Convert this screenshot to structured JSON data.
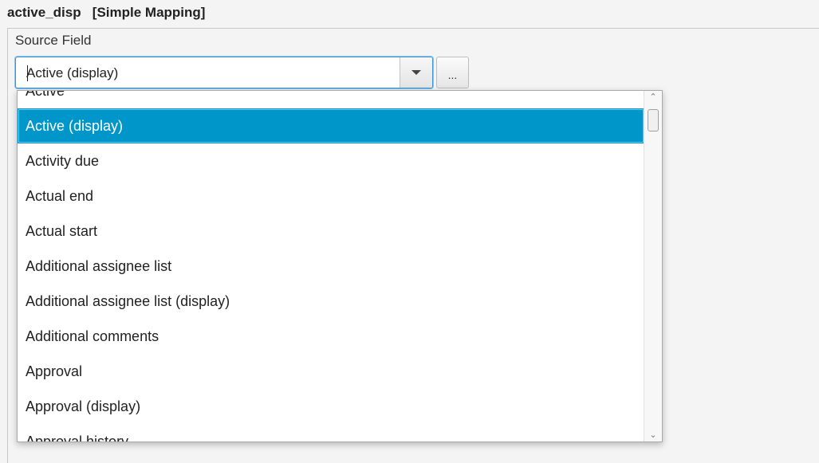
{
  "header": {
    "field_name": "active_disp",
    "mapping_type": "[Simple Mapping]"
  },
  "source_field": {
    "label": "Source Field",
    "value": "Active (display)",
    "browse_label": "..."
  },
  "dropdown": {
    "items": [
      "Active",
      "Active (display)",
      "Activity due",
      "Actual end",
      "Actual start",
      "Additional assignee list",
      "Additional assignee list (display)",
      "Additional comments",
      "Approval",
      "Approval (display)",
      "Approval history"
    ],
    "selected": "Active (display)",
    "scroll_up_icon": "chevron-up-icon",
    "scroll_down_icon": "chevron-down-icon"
  },
  "colors": {
    "selection": "#0096c9",
    "focus_border": "#3b96d6"
  }
}
